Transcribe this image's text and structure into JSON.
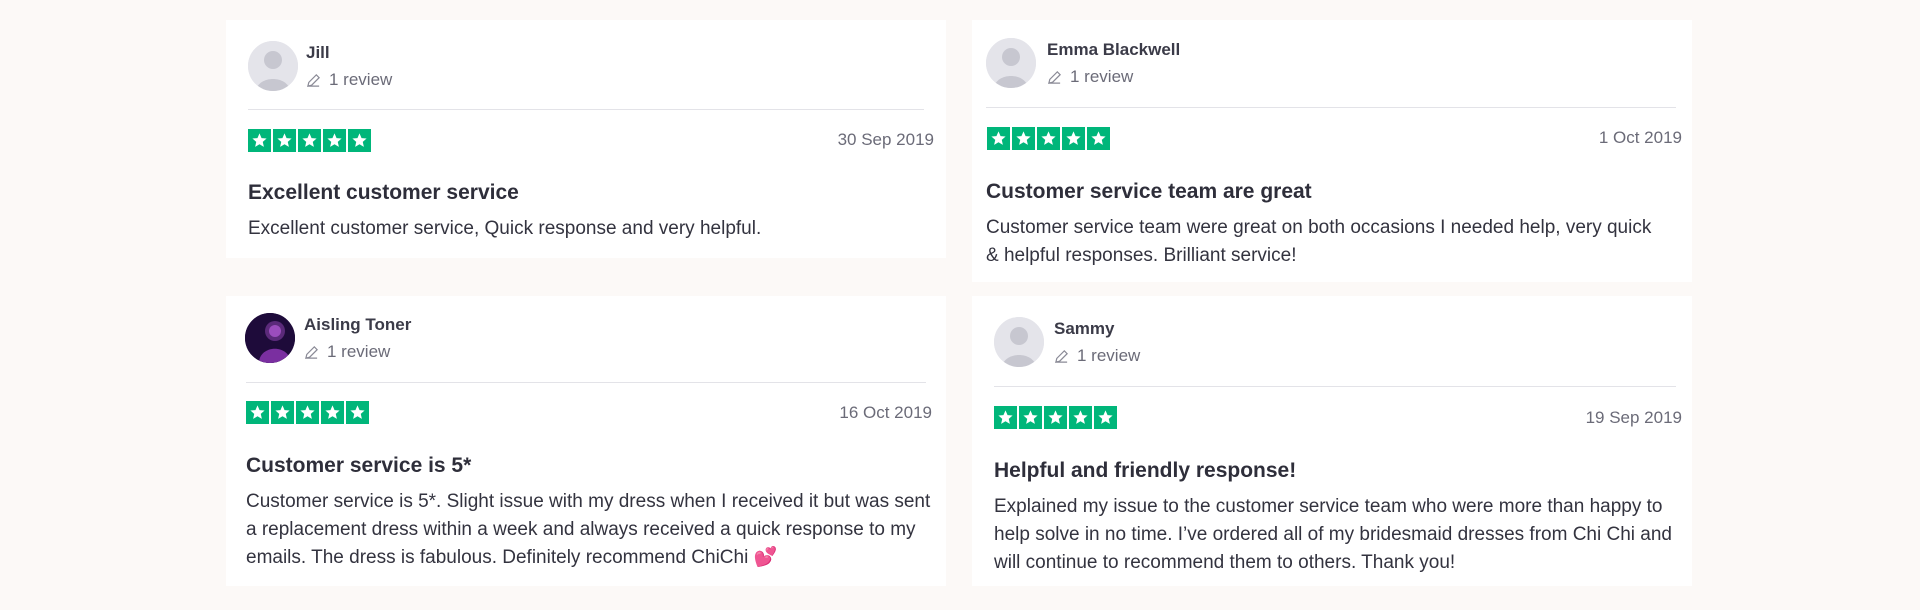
{
  "brand": {
    "star_color": "#00b67a",
    "background": "#fcf9f7"
  },
  "reviews": [
    {
      "author": "Jill",
      "review_count": "1 review",
      "rating": 5,
      "date": "30 Sep 2019",
      "title": "Excellent customer service",
      "body": "Excellent customer service, Quick response and very helpful.",
      "avatar": "default-avatar-icon"
    },
    {
      "author": "Emma Blackwell",
      "review_count": "1 review",
      "rating": 5,
      "date": "1 Oct 2019",
      "title": "Customer service team are great",
      "body": "Customer service team were great on both occasions I needed help, very quick & helpful responses. Brilliant service!",
      "avatar": "default-avatar-icon"
    },
    {
      "author": "Aisling Toner",
      "review_count": "1 review",
      "rating": 5,
      "date": "16 Oct 2019",
      "title": "Customer service is 5*",
      "body": "Customer service is 5*. Slight issue with my dress when I received it but was sent a replacement dress within a week and always received a quick response to my emails. The dress is fabulous. Definitely recommend ChiChi 💕",
      "avatar": "photo-avatar"
    },
    {
      "author": "Sammy",
      "review_count": "1 review",
      "rating": 5,
      "date": "19 Sep 2019",
      "title": "Helpful and friendly response!",
      "body": "Explained my issue to the customer service team who were more than happy to help solve in no time. I’ve ordered all of my bridesmaid dresses from Chi Chi and will continue to recommend them to others. Thank you!",
      "avatar": "default-avatar-icon"
    }
  ]
}
